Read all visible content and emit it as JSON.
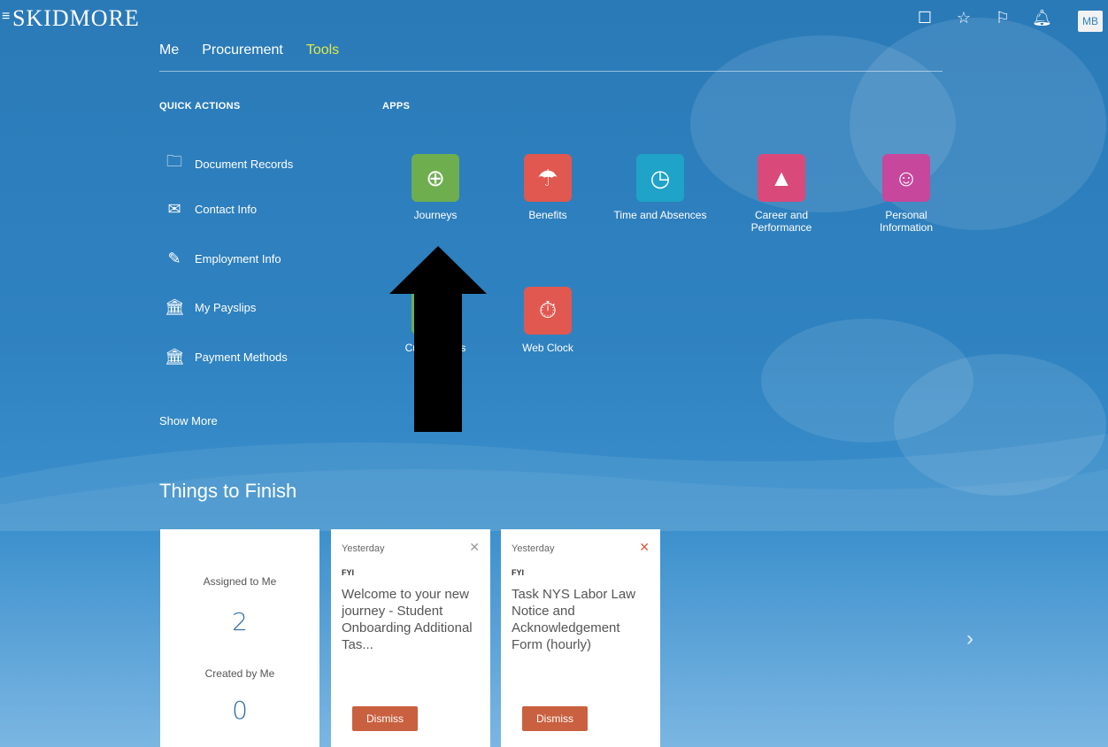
{
  "header": {
    "menu_icon": "hamburger-icon",
    "logo": "SKIDMORE",
    "icons": [
      "square-icon",
      "star-icon",
      "flag-icon",
      "bell-icon"
    ],
    "avatar": "MB"
  },
  "nav": {
    "tabs": [
      {
        "label": "Me"
      },
      {
        "label": "Procurement"
      },
      {
        "label": "Tools"
      }
    ]
  },
  "quick_actions": {
    "heading": "QUICK ACTIONS",
    "items": [
      {
        "label": "Document Records",
        "icon": "folder-icon"
      },
      {
        "label": "Contact Info",
        "icon": "envelope-icon"
      },
      {
        "label": "Employment Info",
        "icon": "briefcase-icon"
      },
      {
        "label": "My Payslips",
        "icon": "bank-icon"
      },
      {
        "label": "Payment Methods",
        "icon": "bank-icon"
      }
    ],
    "show_more": "Show More"
  },
  "apps": {
    "heading": "APPS",
    "items": [
      {
        "label": "Journeys",
        "color": "#6fae4f",
        "icon": "compass-icon"
      },
      {
        "label": "Benefits",
        "color": "#e0584f",
        "icon": "umbrella-icon"
      },
      {
        "label": "Time and Absences",
        "color": "#1fa3c8",
        "icon": "clock-icon"
      },
      {
        "label": "Career and Performance",
        "color": "#d94a7a",
        "icon": "chart-icon"
      },
      {
        "label": "Personal Information",
        "color": "#c6479c",
        "icon": "person-icon"
      },
      {
        "label": "Current Jobs",
        "color": "#6fae4f",
        "icon": "briefcase-icon"
      },
      {
        "label": "Web Clock",
        "color": "#e0584f",
        "icon": "stopwatch-icon"
      }
    ]
  },
  "things_to_finish": {
    "title": "Things to Finish",
    "summary": {
      "assigned_label": "Assigned to Me",
      "assigned_count": "2",
      "created_label": "Created by Me",
      "created_count": "0"
    },
    "cards": [
      {
        "when": "Yesterday",
        "type": "FYI",
        "title": "Welcome to your new journey - Student Onboarding Additional Tas...",
        "button": "Dismiss"
      },
      {
        "when": "Yesterday",
        "type": "FYI",
        "title": "Task NYS Labor Law Notice and Acknowledgement Form (hourly)",
        "button": "Dismiss"
      }
    ]
  },
  "colors": {
    "background": "#2f82c0",
    "accent": "#dfe94a",
    "button": "#c9603f"
  }
}
